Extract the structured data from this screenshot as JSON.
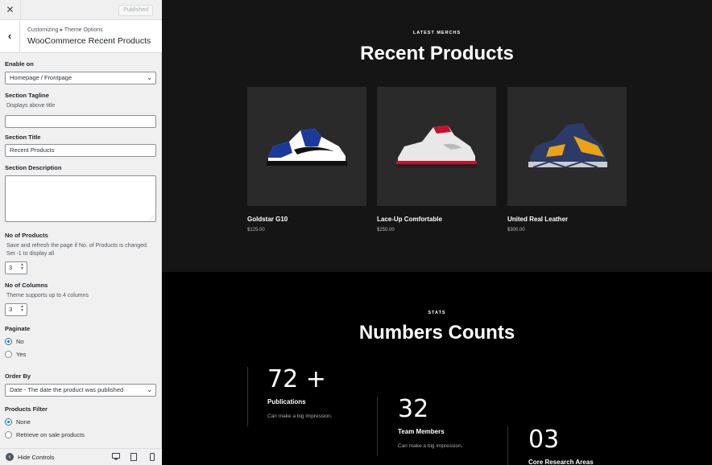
{
  "panel": {
    "close_glyph": "✕",
    "published_label": "Published",
    "back_glyph": "‹",
    "breadcrumb": "Customizing ▸ Theme Options",
    "title": "WooCommerce Recent Products",
    "enable_on": {
      "label": "Enable on",
      "value": "Homepage / Frontpage"
    },
    "section_tagline": {
      "label": "Section Tagline",
      "description": "Displays above title",
      "value": ""
    },
    "section_title": {
      "label": "Section Title",
      "value": "Recent Products"
    },
    "section_description": {
      "label": "Section Description",
      "value": ""
    },
    "no_of_products": {
      "label": "No of Products",
      "description": "Save and refresh the page if No. of Products is changed. Set -1 to display all",
      "value": "3"
    },
    "no_of_columns": {
      "label": "No of Columns",
      "description": "Theme supports up to 4 columns",
      "value": "3"
    },
    "paginate": {
      "label": "Paginate",
      "options": [
        "No",
        "Yes"
      ],
      "selected": "No"
    },
    "order_by": {
      "label": "Order By",
      "value": "Date - The date the product was published"
    },
    "products_filter": {
      "label": "Products Filter",
      "options": [
        "None",
        "Retrieve on sale products"
      ],
      "selected": "None"
    },
    "footer": {
      "hide_controls_label": "Hide Controls"
    }
  },
  "preview": {
    "products_section": {
      "tagline": "LATEST MERCHS",
      "title": "Recent Products",
      "items": [
        {
          "name": "Goldstar G10",
          "price": "$125.00",
          "colors": {
            "upper": "#ffffff",
            "accent": "#1a3a9c",
            "sole": "#111111"
          }
        },
        {
          "name": "Lace-Up Comfortable",
          "price": "$250.00",
          "colors": {
            "upper": "#e8e8e8",
            "accent": "#c8102e",
            "sole": "#222222"
          }
        },
        {
          "name": "United Real Leather",
          "price": "$300.00",
          "colors": {
            "upper": "#2b3a67",
            "accent": "#e8a317",
            "sole": "#cccccc"
          }
        }
      ]
    },
    "stats_section": {
      "tagline": "STATS",
      "title": "Numbers Counts",
      "items": [
        {
          "number": "72 +",
          "label": "Publications",
          "description": "Can make a big impression."
        },
        {
          "number": "32",
          "label": "Team Members",
          "description": "Can make a big impression."
        },
        {
          "number": "03",
          "label": "Core Research Areas",
          "description": ""
        }
      ]
    }
  },
  "colors": {
    "accent": "#2271b1",
    "panel_bg": "#f0f0f1",
    "preview_bg": "#151515"
  }
}
